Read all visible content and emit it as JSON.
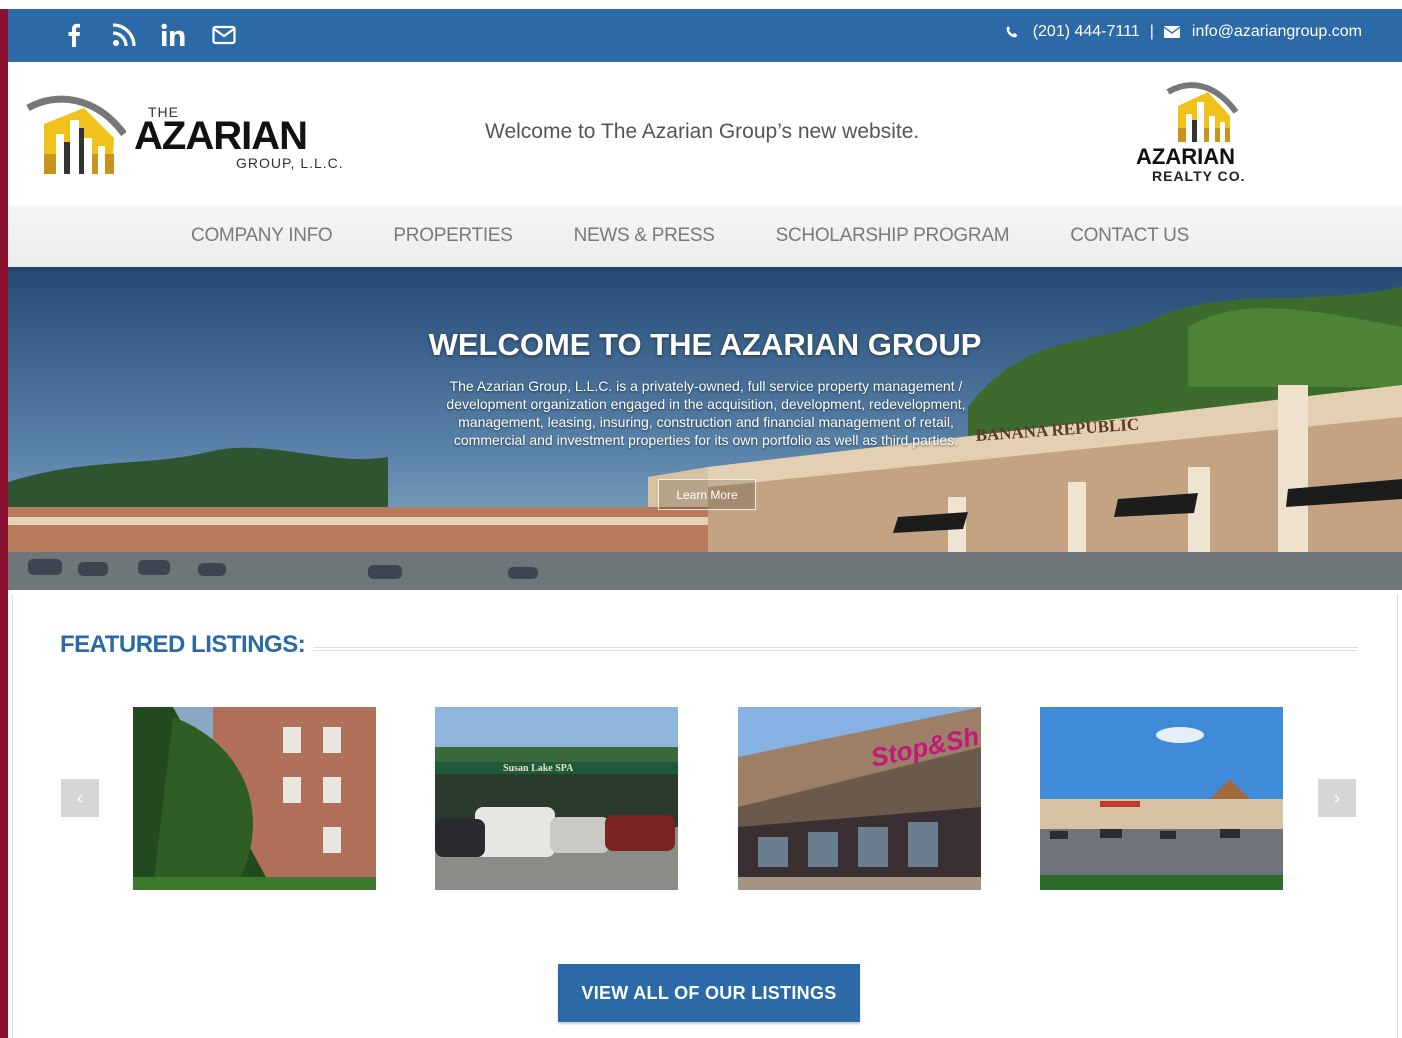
{
  "topbar": {
    "social": [
      {
        "icon": "facebook-icon",
        "glyph": "f"
      },
      {
        "icon": "rss-icon",
        "glyph": ""
      },
      {
        "icon": "linkedin-icon",
        "glyph": "in"
      },
      {
        "icon": "mail-icon",
        "glyph": ""
      }
    ],
    "phone": "(201) 444-7111",
    "separator": "|",
    "email": "info@azariangroup.com"
  },
  "header": {
    "logo_the": "THE",
    "logo_name": "AZARIAN",
    "logo_sub": "GROUP, L.L.C.",
    "welcome": "Welcome to The Azarian Group’s new website.",
    "realty_name": "AZARIAN",
    "realty_sub": "REALTY CO."
  },
  "nav": {
    "items": [
      "COMPANY INFO",
      "PROPERTIES",
      "NEWS & PRESS",
      "SCHOLARSHIP PROGRAM",
      "CONTACT US"
    ]
  },
  "hero": {
    "title": "WELCOME TO THE AZARIAN GROUP",
    "text": "The Azarian Group, L.L.C. is a privately-owned, full service property management / development organization engaged in the acquisition, development, redevelopment, management, leasing, insuring, construction and financial management of retail, commercial and investment properties for its own portfolio as well as third parties.",
    "button": "Learn More",
    "store_sign": "BANANA REPUBLIC"
  },
  "featured": {
    "title": "FEATURED LISTINGS:",
    "prev": "‹",
    "next": "›",
    "listing_2_sign": "Susan Lake SPA",
    "listing_3_sign": "Stop&Sh",
    "view_all": "VIEW ALL OF OUR LISTINGS"
  },
  "colors": {
    "brand_blue": "#2b6aa6",
    "nav_text": "#7a7a7a",
    "accent_gold": "#e8b21c"
  }
}
